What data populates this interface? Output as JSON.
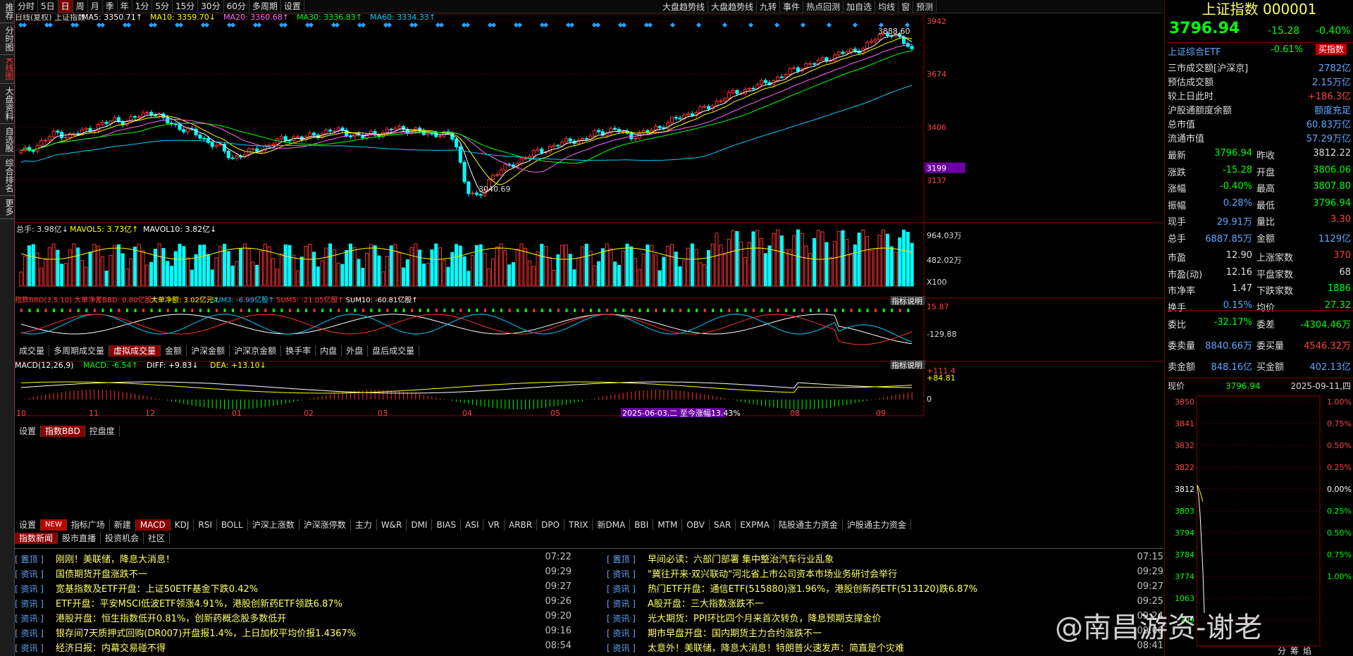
{
  "left_tabs": [
    "推荐",
    "分时图",
    "K线图",
    "大盘资料",
    "自选股",
    "综合排名",
    "更多"
  ],
  "toolbar": {
    "items": [
      "分时",
      "5日",
      "日",
      "周",
      "月",
      "季",
      "年",
      "1分",
      "5分",
      "15分",
      "30分",
      "60分",
      "多周期",
      "设置"
    ],
    "selected": "日",
    "right_items": [
      "大盘趋势线",
      "大盘趋势线",
      "九转",
      "事件",
      "热点回测",
      "加自选",
      "均线",
      "窗",
      "预测"
    ]
  },
  "chart_data": [
    {
      "type": "candlestick",
      "title": "日线(复权) 上证指数",
      "ma_labels": [
        "MA5: 3350.71↑",
        "MA10: 3359.70↓",
        "MA20: 3360.68↑",
        "MA30: 3336.83↑",
        "MA60: 3334.33↑"
      ],
      "y_ticks": [
        "3942",
        "3674",
        "3406",
        "3137"
      ],
      "ylim": [
        2980,
        3942
      ],
      "price_tag": "3199",
      "annot_high": "3888.60",
      "annot_low": "3040.69",
      "x_labels": [
        "10",
        "11",
        "12",
        "01",
        "02",
        "03",
        "04",
        "05",
        "2025-06-03,二 至今涨幅13.43%",
        "08",
        "09"
      ],
      "closes": [
        3280,
        3300,
        3340,
        3380,
        3360,
        3380,
        3400,
        3420,
        3445,
        3432,
        3462,
        3487,
        3448,
        3420,
        3390,
        3370,
        3330,
        3300,
        3250,
        3268,
        3292,
        3310,
        3340,
        3356,
        3347,
        3368,
        3380,
        3392,
        3373,
        3352,
        3380,
        3372,
        3407,
        3391,
        3379,
        3372,
        3369,
        3348,
        3090,
        3040,
        3152,
        3190,
        3220,
        3250,
        3282,
        3300,
        3320,
        3345,
        3336,
        3380,
        3386,
        3389,
        3360,
        3372,
        3400,
        3420,
        3452,
        3475,
        3492,
        3518,
        3560,
        3580,
        3600,
        3620,
        3640,
        3666,
        3700,
        3720,
        3735,
        3760,
        3780,
        3790,
        3812,
        3860,
        3888,
        3850,
        3796
      ]
    },
    {
      "type": "bar",
      "title": "总手",
      "labels": [
        "总手: 3.98亿↓",
        "MAVOL5: 3.73亿↑",
        "MAVOL10: 3.82亿↓"
      ],
      "y_ticks": [
        "964.03万",
        "482.02万",
        "X100"
      ]
    },
    {
      "type": "line",
      "title": "指数BBD",
      "labels": [
        "指数BBD(3,5,10) 大单净差BBD: 0.80亿股↑",
        "大单净额: 3.02亿元↑",
        "SUM3: -6.99亿股↑",
        "SUM5: -21.05亿股↑",
        "SUM10: -60.81亿股↑"
      ],
      "y_ticks": [
        "15.87",
        "-129.88"
      ],
      "help": "指标说明"
    },
    {
      "type": "bar",
      "title": "MACD",
      "labels": [
        "MACD(12,26,9)",
        "MACD: -6.54↑",
        "DIFF: +9.83↓",
        "DEA: +13.10↓"
      ],
      "y_ticks": [
        "111.4",
        "84.81",
        "0"
      ],
      "help": "指标说明"
    }
  ],
  "vol_tabs": [
    "成交量",
    "多周期成交量",
    "虚拟成交量",
    "金额",
    "沪深金额",
    "沪深京金额",
    "换手率",
    "内盘",
    "外盘",
    "盘后成交量"
  ],
  "vol_tab_active": "虚拟成交量",
  "bbd_tabs": [
    "设置",
    "指数BBD",
    "控盘度"
  ],
  "bbd_tab_active": "指数BBD",
  "ind_tabs": [
    "设置",
    "NEW",
    "指标广场",
    "新建",
    "MACD",
    "KDJ",
    "RSI",
    "BOLL",
    "沪深上涨数",
    "沪深涨停数",
    "主力",
    "W&R",
    "DMI",
    "BIAS",
    "ASI",
    "VR",
    "ARBR",
    "DPO",
    "TRIX",
    "新DMA",
    "BBI",
    "MTM",
    "OBV",
    "SAR",
    "EXPMA",
    "陆股通主力资金",
    "沪股通主力资金"
  ],
  "ind_tab_active": "MACD",
  "news_tabs": [
    "指数新闻",
    "股市直播",
    "投资机会",
    "社区"
  ],
  "news_tab_active": "指数新闻",
  "news": [
    {
      "tag": "置顶",
      "text": "刚刚！美联储，降息大消息！",
      "time": "07:22"
    },
    {
      "tag": "资讯",
      "text": "国债期货开盘涨跌不一",
      "time": "09:29"
    },
    {
      "tag": "资讯",
      "text": "宽基指数及ETF开盘：上证50ETF基金下跌0.42%",
      "time": "09:27"
    },
    {
      "tag": "资讯",
      "text": "ETF开盘：平安MSCI低波ETF领涨4.91%，港股创新药ETF领跌6.87%",
      "time": "09:26"
    },
    {
      "tag": "资讯",
      "text": "港股开盘：恒生指数低开0.81%，创新药概念股多数低开",
      "time": "09:20"
    },
    {
      "tag": "资讯",
      "text": "银存间7天质押式回购(DR007)开盘报1.4%，上日加权平均价报1.4367%",
      "time": "09:16"
    },
    {
      "tag": "资讯",
      "text": "经济日报：内幕交易碰不得",
      "time": "08:54"
    },
    {
      "tag": "置顶",
      "text": "早间必读：六部门部署 集中整治汽车行业乱象",
      "time": "07:15"
    },
    {
      "tag": "资讯",
      "text": "\"冀往开来·双兴联动\"河北省上市公司资本市场业务研讨会举行",
      "time": "09:29"
    },
    {
      "tag": "资讯",
      "text": "热门ETF开盘：通信ETF(515880)涨1.96%，港股创新药ETF(513120)跌6.87%",
      "time": "09:27"
    },
    {
      "tag": "资讯",
      "text": "A股开盘：三大指数涨跌不一",
      "time": "09:25"
    },
    {
      "tag": "资讯",
      "text": "光大期货：PPI环比四个月来首次转负，降息预期支撑金价",
      "time": "09:24"
    },
    {
      "tag": "资讯",
      "text": "期市早盘开盘：国内期货主力合约涨跌不一",
      "time": "09:00"
    },
    {
      "tag": "资讯",
      "text": "太意外！美联储，降息大消息！特朗普火速发声：简直是个灾难",
      "time": "08:41"
    }
  ],
  "right": {
    "title": "上证指数 000001",
    "price": "3796.94",
    "change": "-15.28",
    "pct": "-0.40%",
    "etf": {
      "name": "上证综合ETF",
      "pct": "-0.61%",
      "btn": "买指数"
    },
    "rows": [
      {
        "l": "三市成交额[沪深京]",
        "v": "2782亿",
        "c": "#5fa8ff"
      },
      {
        "l": "预估成交额",
        "v": "2.15万亿",
        "c": "#5fa8ff"
      },
      {
        "l": "较上日此时",
        "v": "+186.3亿",
        "c": "#ff4040"
      },
      {
        "l": "沪股通额度余额",
        "v": "额度充足",
        "c": "#5fa8ff"
      },
      {
        "l": "总市值",
        "v": "60.83万亿",
        "c": "#5fa8ff"
      },
      {
        "l": "流通市值",
        "v": "57.29万亿",
        "c": "#5fa8ff"
      }
    ],
    "stats": [
      [
        "最新",
        "3796.94",
        "#00ff00",
        "昨收",
        "3812.22",
        "#ddd"
      ],
      [
        "涨跌",
        "-15.28",
        "#00ff00",
        "开盘",
        "3806.06",
        "#00ff00"
      ],
      [
        "涨幅",
        "-0.40%",
        "#00ff00",
        "最高",
        "3807.80",
        "#00ff00"
      ],
      [
        "振幅",
        "0.28%",
        "#5fa8ff",
        "最低",
        "3796.94",
        "#00ff00"
      ],
      [
        "现手",
        "29.91万",
        "#5fa8ff",
        "量比",
        "3.30",
        "#ff4040"
      ],
      [
        "总手",
        "6887.85万",
        "#5fa8ff",
        "金额",
        "1129亿",
        "#5fa8ff"
      ],
      [
        "市盈",
        "12.90",
        "#ddd",
        "上涨家数",
        "370",
        "#ff4040"
      ],
      [
        "市盈(动)",
        "12.16",
        "#ddd",
        "平盘家数",
        "68",
        "#ddd"
      ],
      [
        "市净率",
        "1.47",
        "#ddd",
        "下跌家数",
        "1886",
        "#00ff00"
      ],
      [
        "换手",
        "0.15%",
        "#5fa8ff",
        "均价",
        "27.32",
        "#00ff00"
      ]
    ],
    "wb": [
      [
        "委比",
        "-32.17%",
        "#00ff00",
        "委差",
        "-4304.46万",
        "#00ff00"
      ],
      [
        "委卖量",
        "8840.66万",
        "#5fa8ff",
        "委买量",
        "4546.32万",
        "#ff4040"
      ],
      [
        "卖金额",
        "848.16亿",
        "#5fa8ff",
        "买金额",
        "402.13亿",
        "#5fa8ff"
      ]
    ],
    "intraday": {
      "label": "现价",
      "price": "3796.94",
      "date": "2025-09-11,四",
      "left_ticks": [
        "3850",
        "3841",
        "3832",
        "3822",
        "3812",
        "3803",
        "3794",
        "3784",
        "3774",
        "1063",
        "709"
      ],
      "right_ticks": [
        "1.00%",
        "0.75%",
        "0.50%",
        "0.25%",
        "0.00%",
        "0.25%",
        "0.50%",
        "0.75%",
        "1.00%"
      ],
      "bottom_tabs": [
        "分",
        "筹",
        "焰"
      ]
    }
  },
  "watermark": "@南昌游资-谢老"
}
